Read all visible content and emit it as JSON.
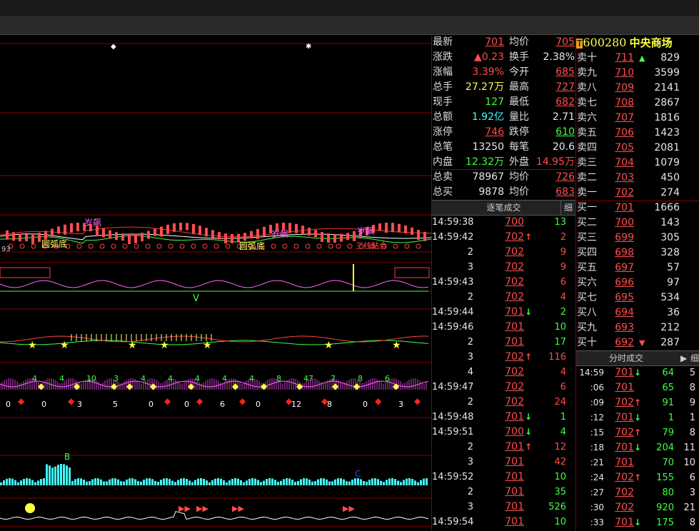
{
  "stock": {
    "code": "600280",
    "name": "中央商场",
    "badge": "T"
  },
  "quote": [
    {
      "l1": "最新",
      "v1": "701",
      "c1": "red",
      "u1": true,
      "l2": "均价",
      "v2": "705",
      "c2": "red",
      "u2": true
    },
    {
      "l1": "涨跌",
      "v1": "▲0.23",
      "c1": "red",
      "u1": false,
      "l2": "换手",
      "v2": "2.38%",
      "c2": "white",
      "u2": false
    },
    {
      "l1": "涨幅",
      "v1": "3.39%",
      "c1": "red",
      "u1": false,
      "l2": "今开",
      "v2": "685",
      "c2": "red",
      "u2": true
    },
    {
      "l1": "总手",
      "v1": "27.27万",
      "c1": "yellow",
      "u1": false,
      "l2": "最高",
      "v2": "727",
      "c2": "red",
      "u2": true
    },
    {
      "l1": "现手",
      "v1": "127",
      "c1": "green",
      "u1": false,
      "l2": "最低",
      "v2": "682",
      "c2": "red",
      "u2": true
    },
    {
      "l1": "总额",
      "v1": "1.92亿",
      "c1": "cyan",
      "u1": false,
      "l2": "量比",
      "v2": "2.71",
      "c2": "white",
      "u2": false
    },
    {
      "l1": "涨停",
      "v1": "746",
      "c1": "red",
      "u1": true,
      "l2": "跌停",
      "v2": "610",
      "c2": "green",
      "u2": true
    },
    {
      "l1": "总笔",
      "v1": "13250",
      "c1": "white",
      "u1": false,
      "l2": "每笔",
      "v2": "20.6",
      "c2": "white",
      "u2": false
    },
    {
      "l1": "内盘",
      "v1": "12.32万",
      "c1": "green",
      "u1": false,
      "l2": "外盘",
      "v2": "14.95万",
      "c2": "red",
      "u2": false
    },
    {
      "l1": "总卖",
      "v1": "78967",
      "c1": "white",
      "u1": false,
      "l2": "均价",
      "v2": "726",
      "c2": "red",
      "u2": true
    },
    {
      "l1": "总买",
      "v1": "9878",
      "c1": "white",
      "u1": false,
      "l2": "均价",
      "v2": "683",
      "c2": "red",
      "u2": true
    }
  ],
  "ticks_header": {
    "title": "逐笔成交",
    "btn": "细"
  },
  "ticks": [
    {
      "t": "14:59:38",
      "p": "700",
      "a": "",
      "v": "13",
      "vc": "green"
    },
    {
      "t": "14:59:42",
      "p": "702",
      "a": "up",
      "v": "2",
      "vc": "red"
    },
    {
      "t": "2",
      "p": "702",
      "a": "",
      "v": "9",
      "vc": "red"
    },
    {
      "t": "3",
      "p": "702",
      "a": "",
      "v": "9",
      "vc": "red"
    },
    {
      "t": "14:59:43",
      "p": "702",
      "a": "",
      "v": "6",
      "vc": "red"
    },
    {
      "t": "2",
      "p": "702",
      "a": "",
      "v": "4",
      "vc": "red"
    },
    {
      "t": "14:59:44",
      "p": "701",
      "a": "down",
      "v": "2",
      "vc": "green"
    },
    {
      "t": "14:59:46",
      "p": "701",
      "a": "",
      "v": "10",
      "vc": "green"
    },
    {
      "t": "2",
      "p": "701",
      "a": "",
      "v": "17",
      "vc": "green"
    },
    {
      "t": "3",
      "p": "702",
      "a": "up",
      "v": "116",
      "vc": "red"
    },
    {
      "t": "4",
      "p": "702",
      "a": "",
      "v": "4",
      "vc": "red"
    },
    {
      "t": "14:59:47",
      "p": "702",
      "a": "",
      "v": "6",
      "vc": "red"
    },
    {
      "t": "2",
      "p": "702",
      "a": "",
      "v": "24",
      "vc": "red"
    },
    {
      "t": "14:59:48",
      "p": "701",
      "a": "down",
      "v": "1",
      "vc": "green"
    },
    {
      "t": "14:59:51",
      "p": "700",
      "a": "down",
      "v": "4",
      "vc": "green"
    },
    {
      "t": "2",
      "p": "701",
      "a": "up",
      "v": "12",
      "vc": "red"
    },
    {
      "t": "3",
      "p": "701",
      "a": "",
      "v": "42",
      "vc": "red"
    },
    {
      "t": "14:59:52",
      "p": "701",
      "a": "",
      "v": "10",
      "vc": "green"
    },
    {
      "t": "2",
      "p": "701",
      "a": "",
      "v": "35",
      "vc": "green"
    },
    {
      "t": "3",
      "p": "701",
      "a": "",
      "v": "526",
      "vc": "green"
    },
    {
      "t": "14:59:54",
      "p": "701",
      "a": "",
      "v": "10",
      "vc": "green"
    }
  ],
  "asks": [
    {
      "l": "卖十",
      "p": "711",
      "v": "829",
      "arrow": "up"
    },
    {
      "l": "卖九",
      "p": "710",
      "v": "3599",
      "arrow": ""
    },
    {
      "l": "卖八",
      "p": "709",
      "v": "2141",
      "arrow": ""
    },
    {
      "l": "卖七",
      "p": "708",
      "v": "2867",
      "arrow": ""
    },
    {
      "l": "卖六",
      "p": "707",
      "v": "1816",
      "arrow": ""
    },
    {
      "l": "卖五",
      "p": "706",
      "v": "1423",
      "arrow": ""
    },
    {
      "l": "卖四",
      "p": "705",
      "v": "2081",
      "arrow": ""
    },
    {
      "l": "卖三",
      "p": "704",
      "v": "1079",
      "arrow": ""
    },
    {
      "l": "卖二",
      "p": "703",
      "v": "450",
      "arrow": ""
    },
    {
      "l": "卖一",
      "p": "702",
      "v": "274",
      "arrow": ""
    }
  ],
  "bids": [
    {
      "l": "买一",
      "p": "701",
      "v": "1666",
      "arrow": ""
    },
    {
      "l": "买二",
      "p": "700",
      "v": "143",
      "arrow": ""
    },
    {
      "l": "买三",
      "p": "699",
      "v": "305",
      "arrow": ""
    },
    {
      "l": "买四",
      "p": "698",
      "v": "328",
      "arrow": ""
    },
    {
      "l": "买五",
      "p": "697",
      "v": "57",
      "arrow": ""
    },
    {
      "l": "买六",
      "p": "696",
      "v": "97",
      "arrow": ""
    },
    {
      "l": "买七",
      "p": "695",
      "v": "534",
      "arrow": ""
    },
    {
      "l": "买八",
      "p": "694",
      "v": "36",
      "arrow": ""
    },
    {
      "l": "买九",
      "p": "693",
      "v": "212",
      "arrow": ""
    },
    {
      "l": "买十",
      "p": "692",
      "v": "287",
      "arrow": "down"
    }
  ],
  "minute_header": {
    "title": "分时成交",
    "btn": "细"
  },
  "minute": [
    {
      "t": "14:59",
      "p": "701",
      "a": "down",
      "v": "64",
      "c": "5"
    },
    {
      "t": ":06",
      "p": "701",
      "a": "",
      "v": "65",
      "c": "8"
    },
    {
      "t": ":09",
      "p": "702",
      "a": "up",
      "v": "91",
      "c": "9"
    },
    {
      "t": ":12",
      "p": "701",
      "a": "down",
      "v": "1",
      "c": "1"
    },
    {
      "t": ":15",
      "p": "702",
      "a": "up",
      "v": "79",
      "c": "8"
    },
    {
      "t": ":18",
      "p": "701",
      "a": "down",
      "v": "204",
      "c": "11"
    },
    {
      "t": ":21",
      "p": "701",
      "a": "",
      "v": "70",
      "c": "10"
    },
    {
      "t": ":24",
      "p": "702",
      "a": "up",
      "v": "155",
      "c": "6"
    },
    {
      "t": ":27",
      "p": "702",
      "a": "",
      "v": "80",
      "c": "3"
    },
    {
      "t": ":30",
      "p": "702",
      "a": "",
      "v": "920",
      "c": "21"
    },
    {
      "t": ":33",
      "p": "701",
      "a": "down",
      "v": "175",
      "c": "8"
    }
  ],
  "chart_labels": {
    "round_bottom_1": "圆弧底",
    "round_bottom_2": "圆弧底",
    "surge_1": "岁飙",
    "surge_2": "岁飙",
    "surge_3": "岁飙",
    "three_line": "三线粘合",
    "left_value": "93",
    "z_counts": [
      "4",
      "4",
      "10",
      "3",
      "4",
      "4",
      "4",
      "4",
      "4",
      "8",
      "47",
      "7",
      "8",
      "6"
    ],
    "small_nums": [
      "0",
      "0",
      "3",
      "5",
      "0",
      "0",
      "6",
      "0",
      "12",
      "8",
      "0",
      "3"
    ]
  },
  "colors": {
    "up": "#ff4d4d",
    "down": "#40ff40",
    "grid": "#8b0000",
    "bg": "#000000"
  }
}
